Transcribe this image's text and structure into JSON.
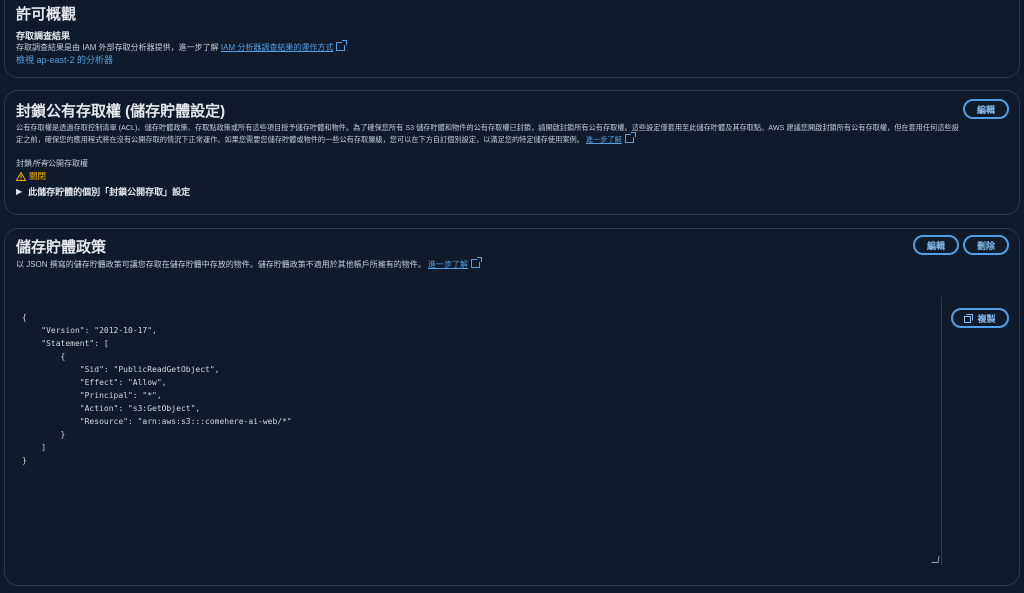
{
  "panel1": {
    "title": "許可概觀",
    "subtitle": "存取調查結果",
    "desc_prefix": "存取調查結果是由 IAM 外部存取分析器提供，進一步了解",
    "desc_link": "IAM 分析器調查結果的運作方式",
    "analyzer_link": "檢視 ap-east-2 的分析器"
  },
  "panel2": {
    "title": "封鎖公有存取權 (儲存貯體設定)",
    "edit_label": "編輯",
    "desc_line1": "公有存取權是透過存取控制清單 (ACL)、儲存貯體政策、存取點政策或所有這些項目授予儲存貯體和物件。為了確保您所有 S3 儲存貯體和物件的公有存取權已封鎖，請開啟封鎖所有公有存取權。這些設定僅套用至此儲存貯體及其存取點。AWS 建議您開啟封鎖所有公有存取權，但在套用任何這些設",
    "desc_line2": "定之前，確保您的應用程式將在沒有公開存取的情況下正常運作。如果您需要您儲存貯體或物件的一些公有存取層級，您可以在下方自訂個別設定，以滿足您的特定儲存使用案例。",
    "desc_link": "進一步了解",
    "block_label_prefix": "封鎖",
    "block_label_italic": "所有",
    "block_label_suffix": "公開存取權",
    "status": "關閉",
    "expander": "此儲存貯體的個別「封鎖公開存取」設定"
  },
  "panel3": {
    "title": "儲存貯體政策",
    "edit_label": "編輯",
    "delete_label": "刪除",
    "copy_label": "複製",
    "desc": "以 JSON 撰寫的儲存貯體政策可讓您存取在儲存貯體中存放的物件。儲存貯體政策不適用於其他帳戶所擁有的物件。",
    "desc_link": "進一步了解",
    "code": [
      "{",
      "    \"Version\": \"2012-10-17\",",
      "    \"Statement\": [",
      "        {",
      "            \"Sid\": \"PublicReadGetObject\",",
      "            \"Effect\": \"Allow\",",
      "            \"Principal\": \"*\",",
      "            \"Action\": \"s3:GetObject\",",
      "            \"Resource\": \"arn:aws:s3:::comehere-ai-web/*\"",
      "        }",
      "    ]",
      "}"
    ]
  },
  "colors": {
    "background": "#0f1b2a",
    "link": "#539fe5",
    "warning": "#f2b000"
  }
}
